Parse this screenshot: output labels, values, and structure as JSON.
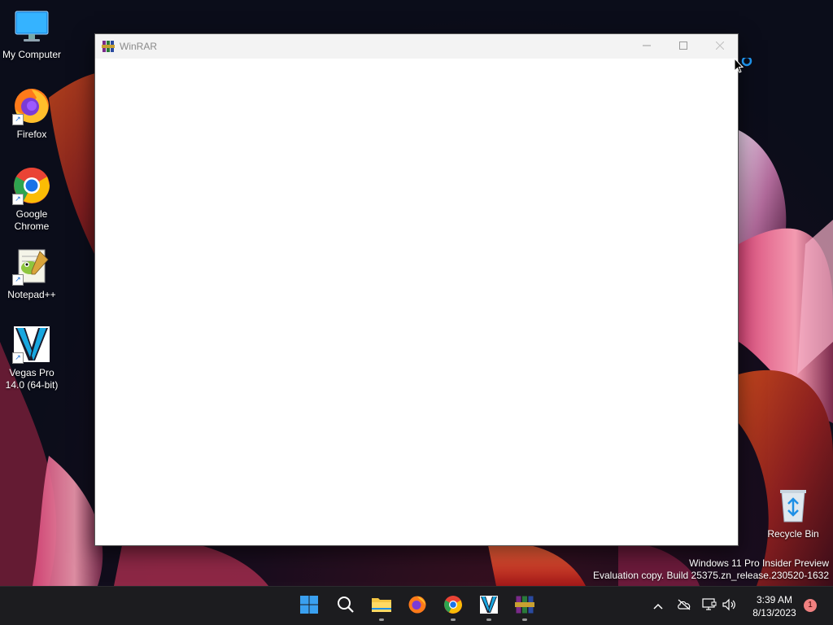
{
  "desktop": {
    "icons": [
      {
        "label": "My Computer",
        "icon": "monitor-icon"
      },
      {
        "label": "Firefox",
        "icon": "firefox-icon"
      },
      {
        "label": "Google Chrome",
        "icon": "chrome-icon"
      },
      {
        "label": "Notepad++",
        "icon": "notepadpp-icon"
      },
      {
        "label": "Vegas Pro 14.0 (64-bit)",
        "icon": "vegas-icon"
      },
      {
        "label": "Recycle Bin",
        "icon": "recycle-bin-icon"
      }
    ]
  },
  "window": {
    "title": "WinRAR",
    "controls": [
      "minimize",
      "maximize",
      "close"
    ]
  },
  "watermark": {
    "line1": "Windows 11 Pro Insider Preview",
    "line2": "Evaluation copy. Build 25375.zn_release.230520-1632"
  },
  "taskbar": {
    "apps": [
      "start",
      "search",
      "file-explorer",
      "firefox",
      "chrome",
      "vegas-pro",
      "winrar"
    ],
    "clock": {
      "time": "3:39 AM",
      "date": "8/13/2023"
    },
    "notification_count": "1"
  },
  "colors": {
    "taskbar_bg": "#1c1c1f",
    "window_titlebar": "#f3f3f3",
    "accent": "#0078d4"
  }
}
